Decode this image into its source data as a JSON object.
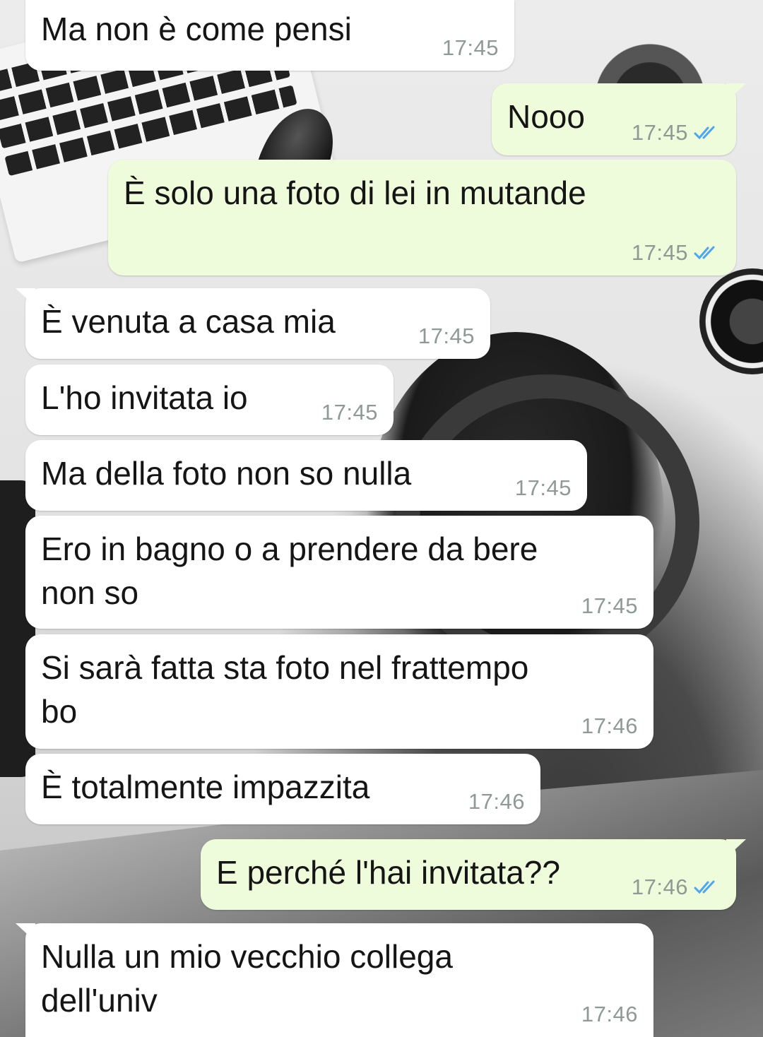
{
  "messages": [
    {
      "direction": "in",
      "text": "Ma non è come pensi",
      "time": "17:45"
    },
    {
      "direction": "out",
      "text": "Nooo",
      "time": "17:45",
      "status_icon": "double-check-read-icon"
    },
    {
      "direction": "out",
      "text": "È solo una foto di lei in mutande",
      "time": "17:45",
      "status_icon": "double-check-read-icon"
    },
    {
      "direction": "in",
      "text": "È venuta a casa mia",
      "time": "17:45"
    },
    {
      "direction": "in",
      "text": "L'ho invitata io",
      "time": "17:45"
    },
    {
      "direction": "in",
      "text": "Ma della foto non so nulla",
      "time": "17:45"
    },
    {
      "direction": "in",
      "text": "Ero in bagno o a prendere da bere\nnon so",
      "time": "17:45"
    },
    {
      "direction": "in",
      "text": "Si sarà fatta sta foto nel frattempo\nbo",
      "time": "17:46"
    },
    {
      "direction": "in",
      "text": "È totalmente impazzita",
      "time": "17:46"
    },
    {
      "direction": "out",
      "text": "E perché l'hai invitata??",
      "time": "17:46",
      "status_icon": "double-check-read-icon"
    },
    {
      "direction": "in",
      "text": "Nulla un mio vecchio collega\ndell'univ",
      "time": "17:46"
    }
  ],
  "colors": {
    "incoming_bubble": "#ffffff",
    "outgoing_bubble": "#effcdb",
    "timestamp": "#8f9a95",
    "read_ticks": "#4fa6ea"
  }
}
